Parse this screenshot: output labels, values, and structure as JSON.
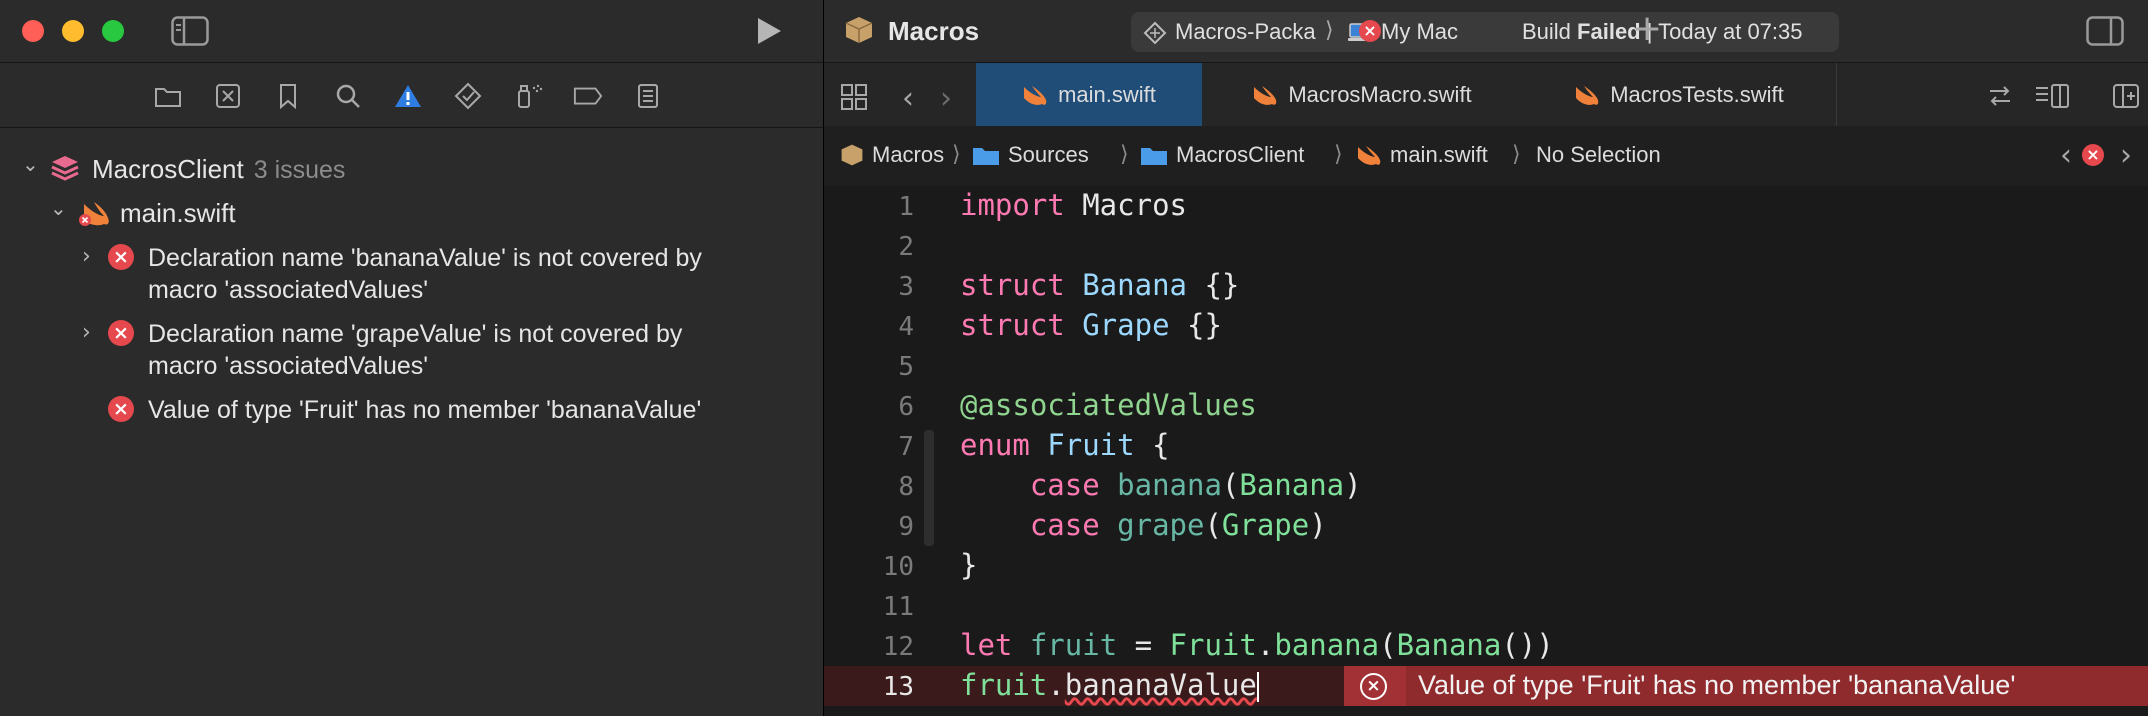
{
  "navigator": {
    "project_name": "MacrosClient",
    "issue_count": "3 issues",
    "file_name": "main.swift",
    "issues": [
      {
        "line1": "Declaration name 'bananaValue' is not covered by",
        "line2": "macro 'associatedValues'"
      },
      {
        "line1": "Declaration name 'grapeValue' is not covered by",
        "line2": "macro 'associatedValues'"
      },
      {
        "line1": "Value of type 'Fruit' has no member 'bananaValue'",
        "line2": ""
      }
    ]
  },
  "toolbar": {
    "project_title": "Macros",
    "scheme": "Macros-Packa",
    "destination": "My Mac",
    "status_prefix": "Build ",
    "status_bold": "Failed",
    "status_suffix": " | Today at 07:35",
    "add_label": "+"
  },
  "tabs": [
    {
      "label": "main.swift",
      "active": true
    },
    {
      "label": "MacrosMacro.swift",
      "active": false
    },
    {
      "label": "MacrosTests.swift",
      "active": false
    }
  ],
  "jump_bar": [
    "Macros",
    "Sources",
    "MacrosClient",
    "main.swift",
    "No Selection"
  ],
  "editor": {
    "line_numbers": [
      "1",
      "2",
      "3",
      "4",
      "5",
      "6",
      "7",
      "8",
      "9",
      "10",
      "11",
      "12",
      "13"
    ],
    "inline_error": "Value of type 'Fruit' has no member 'bananaValue'",
    "code": {
      "l1_kw": "import",
      "l1_rest": " Macros",
      "l3_kw": "struct",
      "l3_type": " Banana",
      "l3_rest": " {}",
      "l4_kw": "struct",
      "l4_type": " Grape",
      "l4_rest": " {}",
      "l6_attr": "@associatedValues",
      "l7_kw": "enum",
      "l7_type": " Fruit",
      "l7_rest": " {",
      "l8_indent": "    ",
      "l8_kw": "case",
      "l8_name": " banana",
      "l8_p1": "(",
      "l8_type": "Banana",
      "l8_p2": ")",
      "l9_indent": "    ",
      "l9_kw": "case",
      "l9_name": " grape",
      "l9_p1": "(",
      "l9_type": "Grape",
      "l9_p2": ")",
      "l10_text": "}",
      "l12_kw": "let",
      "l12_var": " fruit",
      "l12_eq": " = ",
      "l12_type": "Fruit",
      "l12_dot": ".",
      "l12_case": "banana",
      "l12_p1": "(",
      "l12_type2": "Banana",
      "l12_p2": "())",
      "l13_var": "fruit",
      "l13_dot": ".",
      "l13_member": "bananaValue"
    }
  },
  "colors": {
    "error": "#e5484d",
    "keyword": "#ff7ab2",
    "type": "#9dd9ff",
    "accent": "#1f4d78"
  }
}
